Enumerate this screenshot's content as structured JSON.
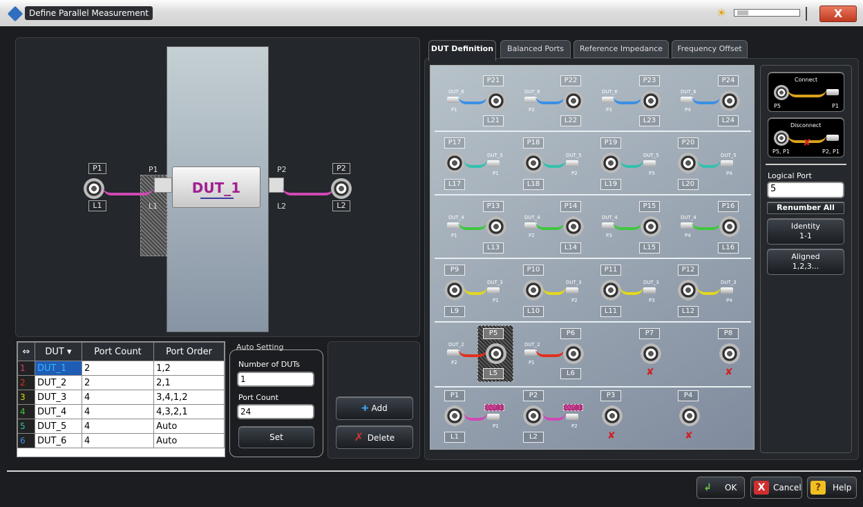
{
  "window": {
    "title": "Define Parallel Measurement",
    "close": "X"
  },
  "schematic": {
    "port_left": "P1",
    "logic_left": "L1",
    "dut_port_left": "P1",
    "dut_logic_left": "L1",
    "dut_name": "DUT_1",
    "dut_port_right": "P2",
    "dut_logic_right": "L2",
    "port_right": "P2",
    "logic_right": "L2"
  },
  "table": {
    "headers": [
      "DUT",
      "Port Count",
      "Port Order"
    ],
    "rows": [
      [
        "1",
        "DUT_1",
        "2",
        "1,2"
      ],
      [
        "2",
        "DUT_2",
        "2",
        "2,1"
      ],
      [
        "3",
        "DUT_3",
        "4",
        "3,4,1,2"
      ],
      [
        "4",
        "DUT_4",
        "4",
        "4,3,2,1"
      ],
      [
        "5",
        "DUT_5",
        "4",
        "Auto"
      ],
      [
        "6",
        "DUT_6",
        "4",
        "Auto"
      ]
    ],
    "row_colors": [
      "#d23d92",
      "#e0301c",
      "#e5d81a",
      "#3fc73e",
      "#31c1ae",
      "#3a8fe4"
    ]
  },
  "auto": {
    "title": "Auto Setting",
    "n_label": "Number of DUTs",
    "n_value": "1",
    "pc_label": "Port Count",
    "pc_value": "24",
    "set": "Set"
  },
  "actions": {
    "add": "Add",
    "delete": "Delete"
  },
  "tabs": [
    "DUT Definition",
    "Balanced Ports",
    "Reference Impedance",
    "Frequency Offset"
  ],
  "grid": {
    "row_a": {
      "ports": [
        "P21",
        "P22",
        "P23",
        "P24"
      ],
      "logic": [
        "L21",
        "L22",
        "L23",
        "L24"
      ],
      "dut": "DUT_6",
      "dut_ports": [
        "P1",
        "P2",
        "P3",
        "P4"
      ]
    },
    "row_b": {
      "ports": [
        "P17",
        "P18",
        "P19",
        "P20"
      ],
      "logic": [
        "L17",
        "L18",
        "L19",
        "L20"
      ],
      "dut": "DUT_5",
      "dut_ports": [
        "P1",
        "P2",
        "P3",
        "P4"
      ]
    },
    "row_c": {
      "ports": [
        "P13",
        "P14",
        "P15",
        "P16"
      ],
      "logic": [
        "L13",
        "L14",
        "L15",
        "L16"
      ],
      "dut": "DUT_4",
      "dut_ports": [
        "P1",
        "P2",
        "P3",
        "P4"
      ]
    },
    "row_d": {
      "ports": [
        "P9",
        "P10",
        "P11",
        "P12"
      ],
      "logic": [
        "L9",
        "L10",
        "L11",
        "L12"
      ],
      "dut": "DUT_3",
      "dut_ports": [
        "P1",
        "P2",
        "P3",
        "P4"
      ]
    },
    "row_e": {
      "ports": [
        "P5",
        "P6",
        "P7",
        "P8"
      ],
      "logic": [
        "L5",
        "L6"
      ],
      "dut": "DUT_2",
      "dut_ports": [
        "P2",
        "P1"
      ]
    },
    "row_f": {
      "ports": [
        "P1",
        "P2",
        "P3",
        "P4"
      ],
      "logic": [
        "L1",
        "L2"
      ],
      "dut": "DUT_1",
      "dut_ports": [
        "P1",
        "P2"
      ]
    }
  },
  "side": {
    "connect": "Connect",
    "connect_left": "P5",
    "connect_right": "P1",
    "disconnect": "Disconnect",
    "disconnect_left": "P5, P1",
    "disconnect_right": "P2, P1",
    "logical_port": "Logical Port",
    "logical_port_value": "5",
    "renumber": "Renumber All",
    "identity": "Identity",
    "identity_sub": "1-1",
    "aligned": "Aligned",
    "aligned_sub": "1,2,3..."
  },
  "footer": {
    "ok": "OK",
    "cancel": "Cancel",
    "help": "Help"
  }
}
